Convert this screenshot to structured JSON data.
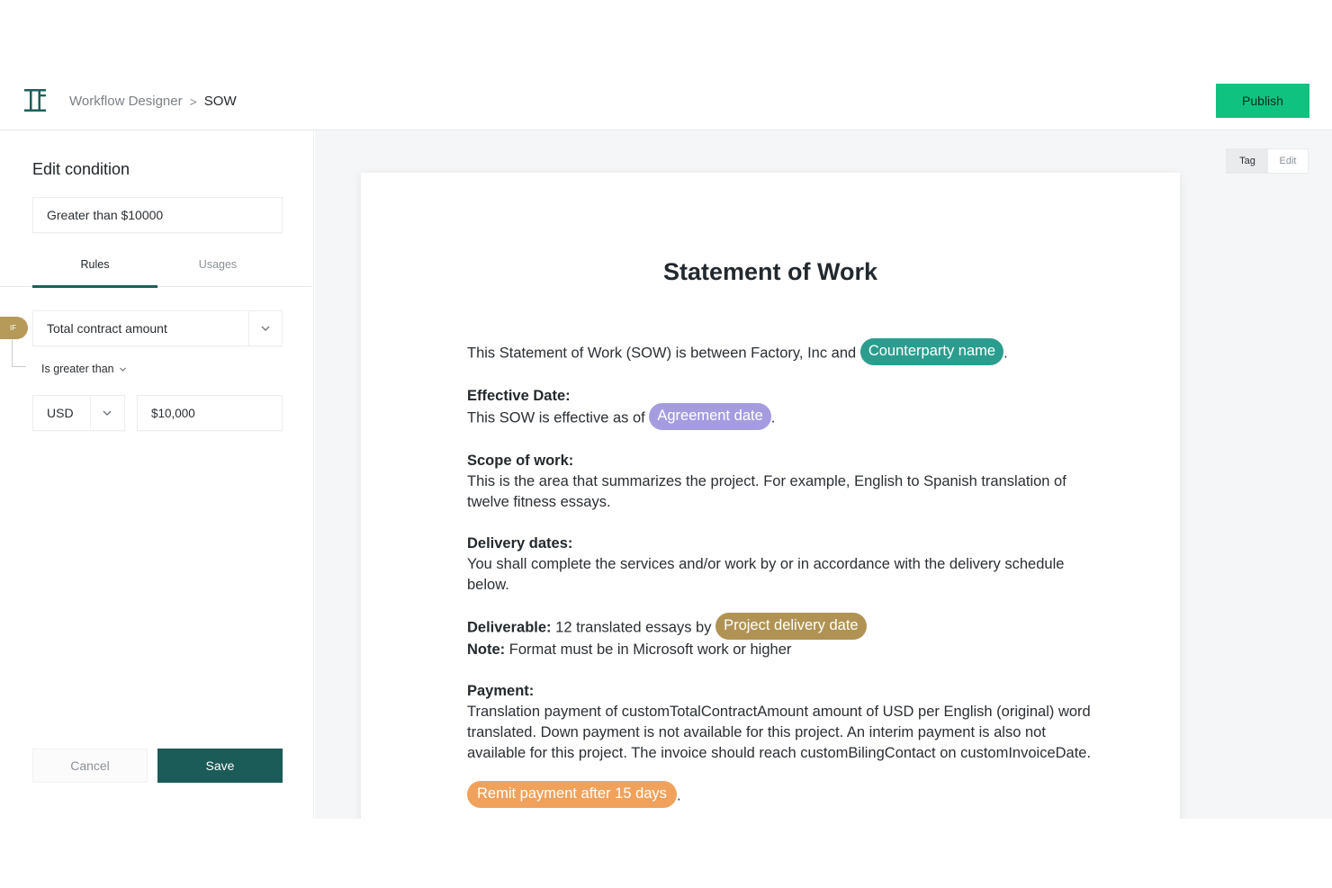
{
  "header": {
    "breadcrumb_root": "Workflow Designer",
    "breadcrumb_separator": ">",
    "breadcrumb_current": "SOW",
    "publish_label": "Publish",
    "accent_color": "#10c27f"
  },
  "sidebar": {
    "title": "Edit condition",
    "condition_name": "Greater than $10000",
    "tabs": [
      {
        "label": "Rules",
        "active": true
      },
      {
        "label": "Usages",
        "active": false
      }
    ],
    "if_badge": "IF",
    "field": "Total contract amount",
    "operator": "Is greater than",
    "currency": "USD",
    "amount": "$10,000",
    "cancel_label": "Cancel",
    "save_label": "Save",
    "save_color": "#1b5b58"
  },
  "toolbar": {
    "tag_label": "Tag",
    "edit_label": "Edit"
  },
  "document": {
    "title": "Statement of Work",
    "intro_text": "This Statement of Work (SOW) is between Factory, Inc and",
    "counterparty_tag": "Counterparty name",
    "effective_heading": "Effective Date:",
    "effective_text": "This SOW is effective as of",
    "agreement_tag": "Agreement date",
    "scope_heading": "Scope of work:",
    "scope_text": "This is the area that summarizes the project. For example, English to Spanish translation of twelve fitness essays.",
    "delivery_heading": "Delivery dates:",
    "delivery_text": "You shall complete the services and/or work by or in accordance with the delivery schedule below.",
    "deliverable_label": "Deliverable:",
    "deliverable_text": "12 translated essays by",
    "project_delivery_tag": "Project delivery date",
    "note_label": "Note:",
    "note_text": "Format must be in Microsoft work or higher",
    "payment_heading": "Payment:",
    "payment_text": "Translation payment of customTotalContractAmount amount of USD per English (original) word translated. Down payment is not available for this project. An interim payment is also not available for this project. The invoice should reach customBilingContact on customInvoiceDate.",
    "remit_tag": "Remit payment after 15 days",
    "period": "."
  }
}
